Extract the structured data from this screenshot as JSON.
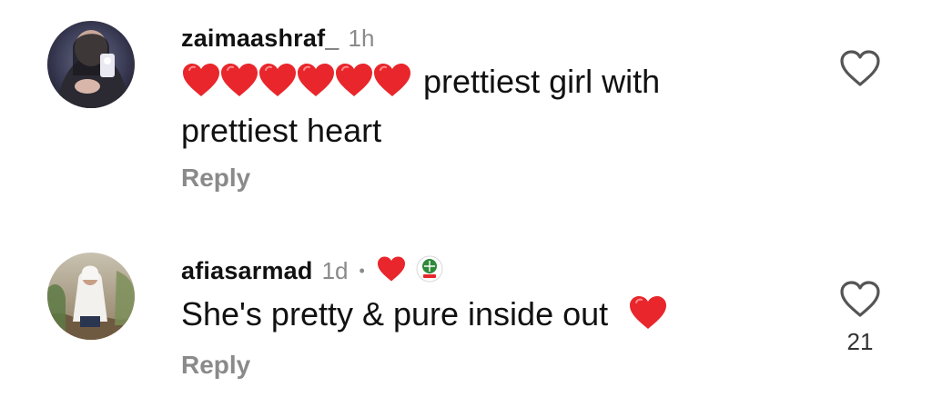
{
  "comments": [
    {
      "username": "zaimaashraf_",
      "time": "1h",
      "emoji": [
        "red-heart",
        "red-heart",
        "red-heart",
        "red-heart",
        "red-heart",
        "red-heart"
      ],
      "text_line1": "prettiest girl with",
      "text_line2": "prettiest heart",
      "reply_label": "Reply",
      "like_count": ""
    },
    {
      "username": "afiasarmad",
      "time": "1d",
      "separator": "•",
      "badges": [
        "red-heart",
        "cinema-logo"
      ],
      "text": "She's pretty & pure inside out",
      "trailing_emoji": "red-heart",
      "reply_label": "Reply",
      "like_count": "21"
    }
  ],
  "colors": {
    "heart_red": "#e8262b",
    "muted_gray": "#8a8a8a",
    "text": "#111111",
    "logo_green": "#2f8a3a"
  },
  "icons": {
    "like": "heart-outline-icon"
  }
}
